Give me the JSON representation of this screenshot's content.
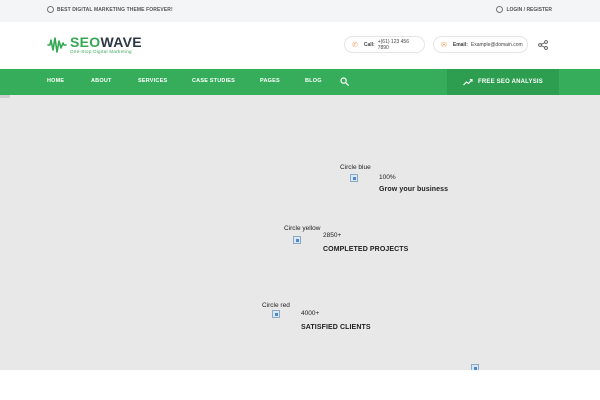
{
  "topbar": {
    "tagline": "BEST DIGITAL MARKETING THEME FOREVER!",
    "login": "LOGIN / REGISTER"
  },
  "header": {
    "logo_seo": "SEO",
    "logo_wave": "WAVE",
    "logo_tagline": "One-Stop Digital Marketing",
    "phone_label": "Call:",
    "phone_value": "+(61) 123 456 7890",
    "email_label": "Email:",
    "email_value": "Example@domain.com"
  },
  "nav": {
    "items": [
      "HOME",
      "ABOUT",
      "SERVICES",
      "CASE STUDIES",
      "PAGES",
      "BLOG"
    ],
    "cta": "FREE SEO ANALYSIS"
  },
  "stats": [
    {
      "img_alt": "Circle blue",
      "value": "100%",
      "label": "Grow your business"
    },
    {
      "img_alt": "Circle yellow",
      "value": "2850+",
      "label": "COMPLETED PROJECTS"
    },
    {
      "img_alt": "Circle red",
      "value": "4000+",
      "label": "SATISFIED CLIENTS"
    }
  ],
  "colors": {
    "brand_green": "#36ad5a",
    "cta_green": "#2d9e4f",
    "dark": "#2e3744"
  }
}
